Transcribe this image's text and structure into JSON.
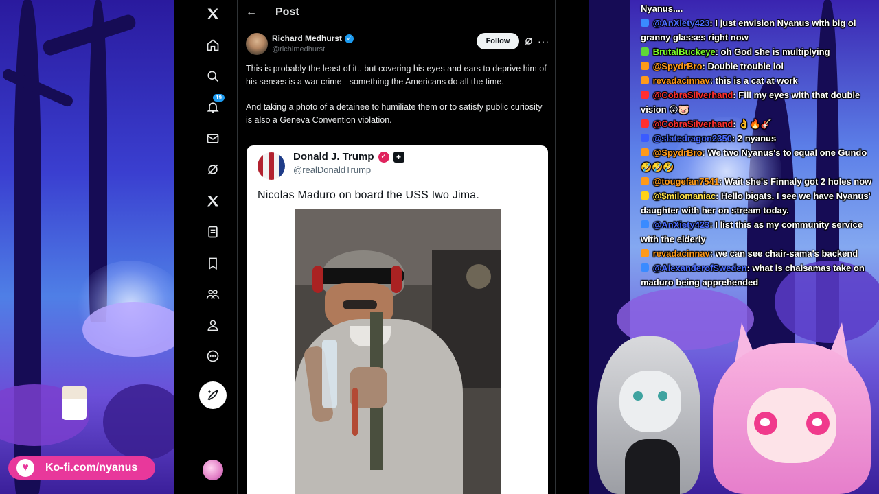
{
  "x_post": {
    "header_title": "Post",
    "nav": {
      "notifications_badge": "19",
      "icons": [
        "x-logo-icon",
        "home-icon",
        "search-icon",
        "notifications-icon",
        "messages-icon",
        "grok-icon",
        "premium-x-icon",
        "lists-icon",
        "bookmarks-icon",
        "communities-icon",
        "profile-icon",
        "more-icon"
      ]
    },
    "author": {
      "name": "Richard Medhurst",
      "handle": "@richimedhurst",
      "follow_label": "Follow"
    },
    "text": {
      "p1": "This is probably the least of it.. but covering his eyes and ears to deprive him of his senses is a war crime - something the Americans do all the time.",
      "p2": "And taking a photo of a detainee to humiliate them or to satisfy public curiosity is also a Geneva Convention violation."
    },
    "quoted": {
      "name": "Donald J. Trump",
      "handle": "@realDonaldTrump",
      "text": "Nicolas Maduro on board the USS Iwo Jima."
    }
  },
  "chat": {
    "messages": [
      {
        "user": "",
        "text": "Nyanus....",
        "color": "#ffffff"
      },
      {
        "user": "@AnXiety423",
        "text": ": I just envision Nyanus with big ol granny glasses right now",
        "color": "#4a6bff"
      },
      {
        "user": "BrutalBuckeye",
        "text": ": oh God she is multiplying",
        "color": "#7dff2a"
      },
      {
        "user": "@SpydrBro",
        "text": ": Double trouble lol",
        "color": "#ff9a1a"
      },
      {
        "user": "revadacinnav",
        "text": ": this is a cat at work",
        "color": "#ff9a1a"
      },
      {
        "user": "@CobraSilverhand",
        "text": ": Fill my eyes with that double vision 😮🐷",
        "color": "#ff2f2f"
      },
      {
        "user": "@CobraSilverhand",
        "text": ": 👌🔥🎸",
        "color": "#ff2f2f"
      },
      {
        "user": "@slatedragon2350",
        "text": ": 2 nyanus",
        "color": "#4a6bff"
      },
      {
        "user": "@SpydrBro",
        "text": ": We two Nyanus's to equal one Gundo 🤣🤣🤣",
        "color": "#ff9a1a"
      },
      {
        "user": "@tougefan7541",
        "text": ": Wait she's Finnaly got 2 holes now",
        "color": "#ff9a1a"
      },
      {
        "user": "@$milomaniac",
        "text": ": Hello bigats. I see we have Nyanus' daughter with her on stream today.",
        "color": "#ffe34a"
      },
      {
        "user": "@AnXiety423",
        "text": ": I list this as my community service with the elderly",
        "color": "#4a6bff"
      },
      {
        "user": "revadacinnav",
        "text": ": we can see chair-sama's backend",
        "color": "#ff9a1a"
      },
      {
        "user": "@AlexanderofSweden",
        "text": ": what is chaisamas take on maduro being apprehended",
        "color": "#4a6bff"
      }
    ]
  },
  "kofi": {
    "label": "Ko-fi.com/nyanus"
  }
}
